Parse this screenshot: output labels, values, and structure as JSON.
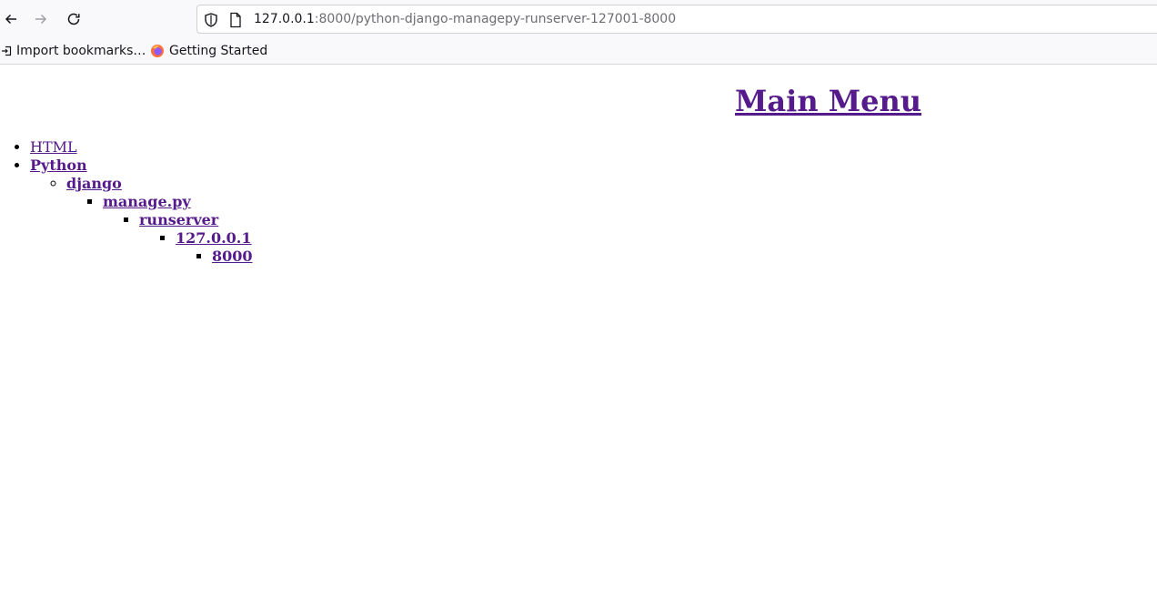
{
  "browser": {
    "url_host": "127.0.0.1",
    "url_rest": ":8000/python-django-managepy-runserver-127001-8000",
    "bookmarks": [
      {
        "label": "Import bookmarks…",
        "icon": "import-icon"
      },
      {
        "label": "Getting Started",
        "icon": "firefox-icon"
      }
    ]
  },
  "page": {
    "title": "Main Menu",
    "menu": {
      "html": "HTML",
      "python": "Python",
      "django": "django",
      "managepy": "manage.py",
      "runserver": "runserver",
      "host": "127.0.0.1",
      "port": "8000"
    }
  },
  "colors": {
    "link_visited": "#551a8b"
  }
}
